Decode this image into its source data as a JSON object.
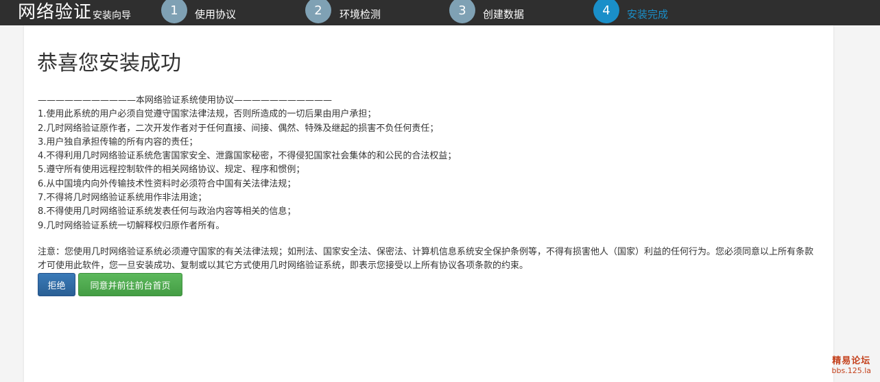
{
  "header": {
    "brand_title": "网络验证",
    "brand_subtitle": "安装向导",
    "steps": [
      {
        "number": "1",
        "label": "使用协议"
      },
      {
        "number": "2",
        "label": "环境检测"
      },
      {
        "number": "3",
        "label": "创建数据"
      },
      {
        "number": "4",
        "label": "安装完成"
      }
    ],
    "colors": {
      "bar": "#2f2f2f",
      "step_inactive": "#7fa1b4",
      "step_active": "#1a8fc9",
      "label_inactive": "#ffffff",
      "label_active": "#1a8fc9"
    }
  },
  "main": {
    "title": "恭喜您安装成功",
    "agreement_lines": [
      "———————————本网络验证系统使用协议———————————",
      "1.使用此系统的用户必须自觉遵守国家法律法规，否则所造成的一切后果由用户承担；",
      "2.几时网络验证原作者，二次开发作者对于任何直接、间接、偶然、特殊及继起的损害不负任何责任；",
      "3.用户独自承担传输的所有内容的责任；",
      "4.不得利用几时网络验证系统危害国家安全、泄露国家秘密，不得侵犯国家社会集体的和公民的合法权益；",
      "5.遵守所有使用远程控制软件的相关网络协议、规定、程序和惯例；",
      "6.从中国境内向外传输技术性资料时必须符合中国有关法律法规；",
      "7.不得将几时网络验证系统用作非法用途；",
      "8.不得使用几时网络验证系统发表任何与政治内容等相关的信息；",
      "9.几时网络验证系统一切解释权归原作者所有。"
    ],
    "notice": "注意：您使用几时网络验证系统必须遵守国家的有关法律法规；如刑法、国家安全法、保密法、计算机信息系统安全保护条例等，不得有损害他人（国家）利益的任何行为。您必须同意以上所有条款才可使用此软件，您一旦安装成功、复制或以其它方式使用几时网络验证系统，即表示您接受以上所有协议各项条款的约束。",
    "buttons": {
      "reject": "拒绝",
      "agree": "同意并前往前台首页"
    }
  },
  "watermark": {
    "line1": "精易论坛",
    "line2": "bbs.125.la"
  }
}
